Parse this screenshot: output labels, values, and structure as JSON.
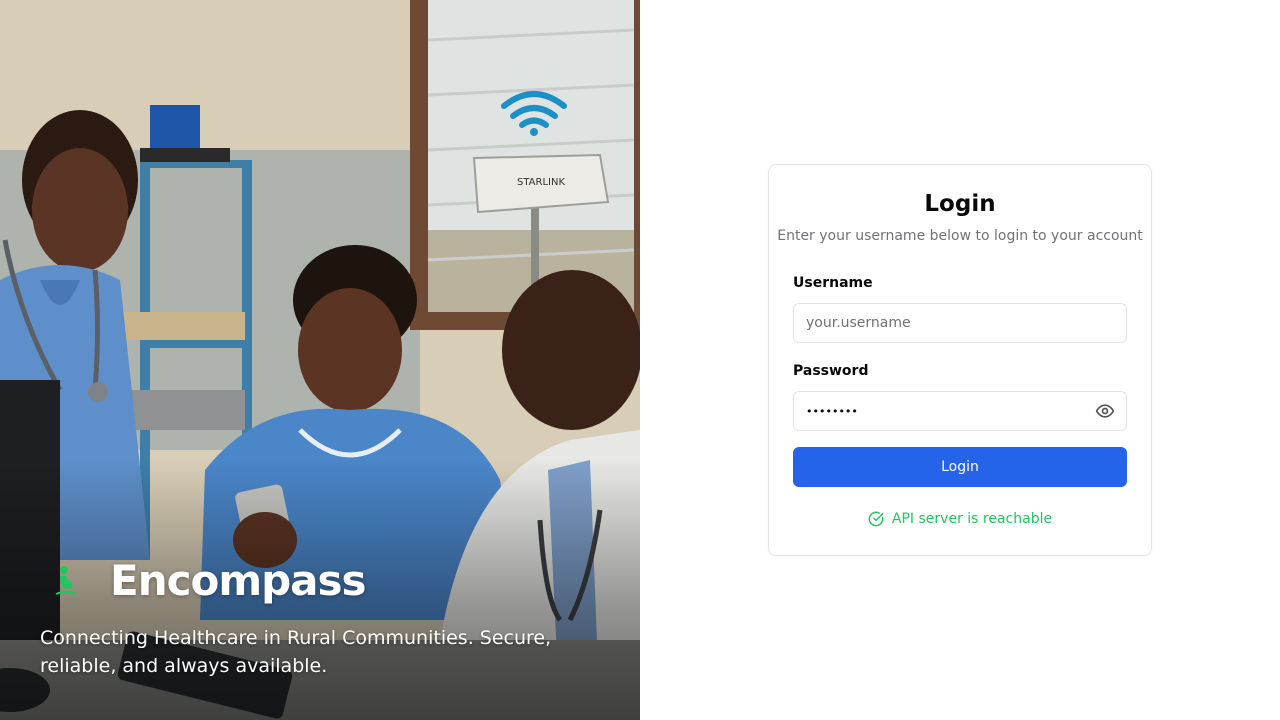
{
  "hero": {
    "brand_name": "Encompass",
    "tagline": "Connecting Healthcare in Rural Communities. Secure, reliable, and always available.",
    "device_label": "STARLINK"
  },
  "login": {
    "title": "Login",
    "subtitle": "Enter your username below to login to your account",
    "username_label": "Username",
    "username_placeholder": "your.username",
    "username_value": "",
    "password_label": "Password",
    "password_value": "••••••••",
    "submit_label": "Login",
    "status_text": "API server is reachable",
    "icons": {
      "password_toggle": "eye-icon",
      "status": "check-circle-icon"
    }
  },
  "colors": {
    "primary": "#2563eb",
    "success": "#22c55e",
    "muted_text": "#71717a",
    "border": "#e4e4e7"
  }
}
